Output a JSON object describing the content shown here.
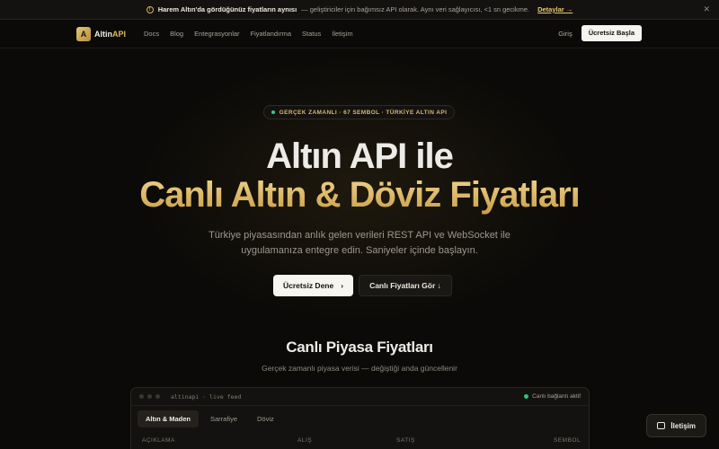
{
  "announcement": {
    "bold": "Harem Altın'da gördüğünüz fiyatların aynısı",
    "text": "— geliştiriciler için bağımsız API olarak. Aynı veri sağlayıcısı, <1 sn gecikme.",
    "link": "Detaylar →"
  },
  "nav": {
    "logo_text": "Altin",
    "logo_accent": "API",
    "logo_letter": "A",
    "links": [
      "Docs",
      "Blog",
      "Entegrasyonlar",
      "Fiyatlandırma",
      "Status",
      "İletişim"
    ],
    "login": "Giriş",
    "cta": "Ücretsiz Başla"
  },
  "hero": {
    "badge": "GERÇEK ZAMANLI · 67 SEMBOL · TÜRKİYE ALTIN API",
    "title_line1": "Altın API ile",
    "title_line2": "Canlı Altın & Döviz Fiyatları",
    "subtitle": "Türkiye piyasasından anlık gelen verileri REST API ve WebSocket ile uygulamanıza entegre edin. Saniyeler içinde başlayın.",
    "primary_button": "Ücretsiz Dene",
    "secondary_button": "Canlı Fiyatları Gör ↓"
  },
  "live": {
    "title": "Canlı Piyasa Fiyatları",
    "subtitle": "Gerçek zamanlı piyasa verisi — değiştiği anda güncellenir",
    "terminal_title": "altinapi · live feed",
    "status": "Canlı bağlantı aktif",
    "tabs": [
      "Altın & Maden",
      "Sarrafiye",
      "Döviz"
    ],
    "columns": [
      "AÇIKLAMA",
      "ALIŞ",
      "SATIŞ",
      "SEMBOL"
    ]
  },
  "chat": {
    "label": "İletişim"
  },
  "colors": {
    "accent": "#d9b562",
    "live_green": "#2fc07e",
    "background": "#0b0a08"
  }
}
